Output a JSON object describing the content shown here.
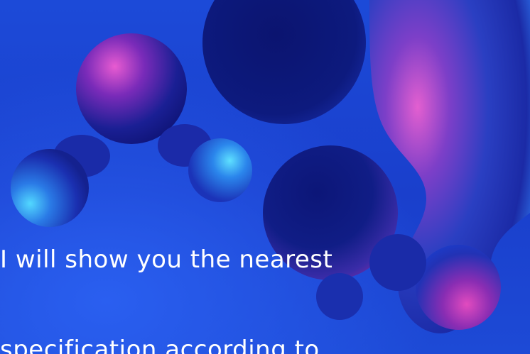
{
  "slide": {
    "line1": "I will show you the nearest",
    "line2": "specification according to"
  },
  "colors": {
    "background": "#1b45d8",
    "deep_navy": "#0b1a7a",
    "magenta": "#e04ac9",
    "cyan": "#4ad6ff",
    "text": "#ffffff"
  }
}
